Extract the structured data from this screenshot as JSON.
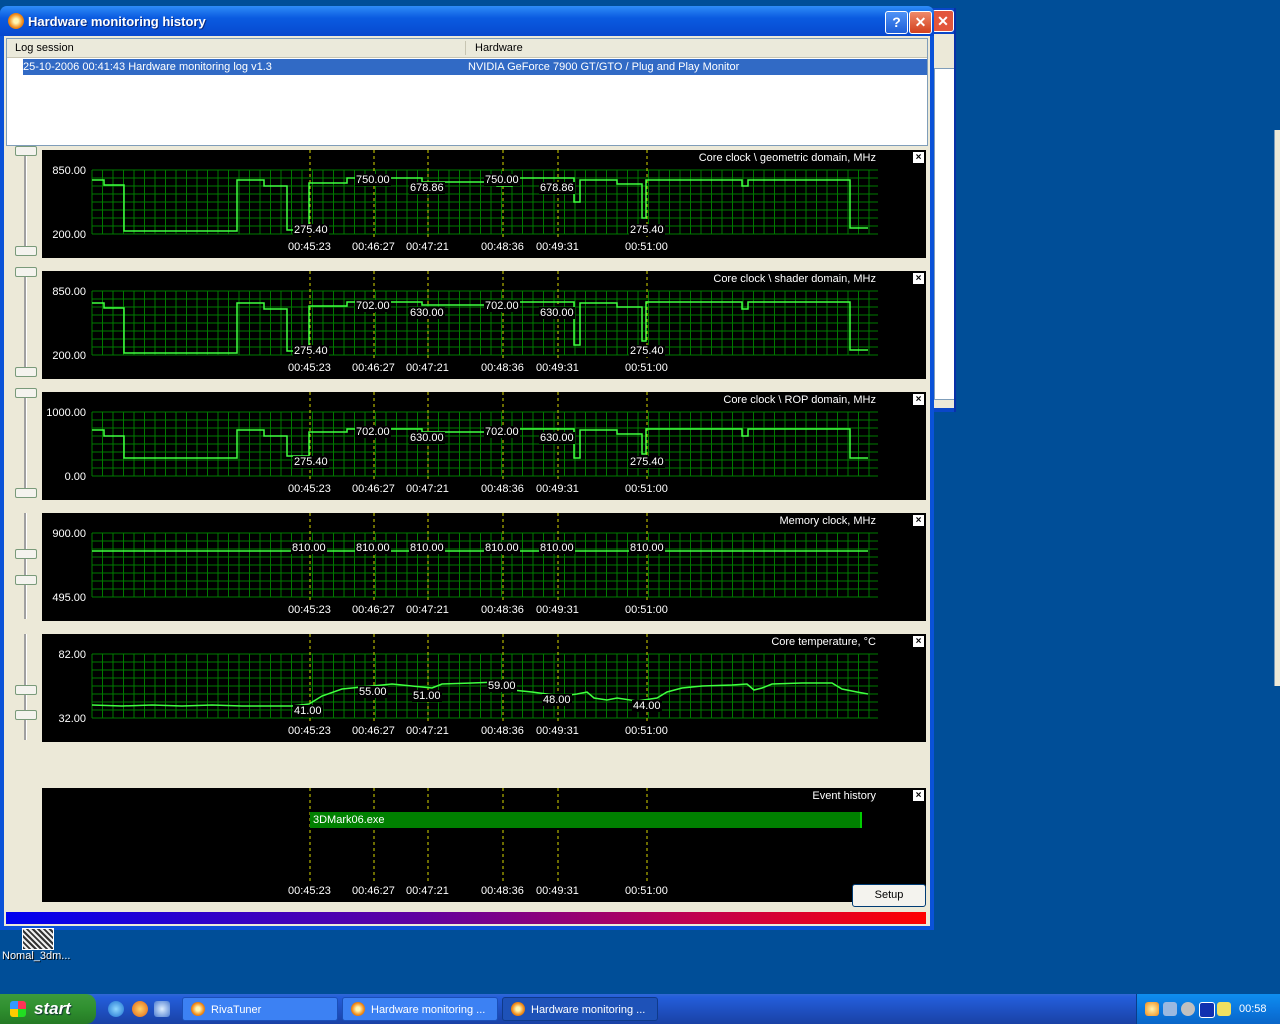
{
  "window": {
    "title": "Hardware monitoring history",
    "help_label": "?",
    "close_label": "✕"
  },
  "log_list": {
    "columns": [
      "Log session",
      "Hardware"
    ],
    "selected_row": {
      "session": "25-10-2006 00:41:43 Hardware monitoring log v1.3",
      "hardware": "NVIDIA GeForce 7900 GT/GTO / Plug and Play Monitor"
    }
  },
  "time_labels": [
    "00:45:23",
    "00:46:27",
    "00:47:21",
    "00:48:36",
    "00:49:31",
    "00:51:00"
  ],
  "graphs": [
    {
      "title": "Core clock \\ geometric domain, MHz",
      "y_max": "850.00",
      "y_min": "200.00",
      "values": [
        "275.40",
        "750.00",
        "678.86",
        "750.00",
        "678.86",
        "275.40"
      ]
    },
    {
      "title": "Core clock \\ shader domain, MHz",
      "y_max": "850.00",
      "y_min": "200.00",
      "values": [
        "275.40",
        "702.00",
        "630.00",
        "702.00",
        "630.00",
        "275.40"
      ]
    },
    {
      "title": "Core clock \\ ROP domain, MHz",
      "y_max": "1000.00",
      "y_min": "0.00",
      "values": [
        "275.40",
        "702.00",
        "630.00",
        "702.00",
        "630.00",
        "275.40"
      ]
    },
    {
      "title": "Memory clock, MHz",
      "y_max": "900.00",
      "y_min": "495.00",
      "values": [
        "810.00",
        "810.00",
        "810.00",
        "810.00",
        "810.00",
        "810.00"
      ]
    },
    {
      "title": "Core temperature, °C",
      "y_max": "82.00",
      "y_min": "32.00",
      "values": [
        "41.00",
        "55.00",
        "51.00",
        "59.00",
        "48.00",
        "44.00"
      ]
    }
  ],
  "event_history": {
    "title": "Event history",
    "event_label": "3DMark06.exe"
  },
  "setup_label": "Setup",
  "desktop_icon": {
    "label": "Nomal_3dm..."
  },
  "taskbar": {
    "start_label": "start",
    "tasks": [
      "RivaTuner",
      "Hardware monitoring ...",
      "Hardware monitoring ..."
    ],
    "clock": "00:58"
  },
  "colors": {
    "graph_background": "#000000",
    "grid": "#007a00",
    "trace": "#40ff40",
    "marker": "#d8d800",
    "selection": "#316ac5",
    "desktop": "#004e98"
  }
}
